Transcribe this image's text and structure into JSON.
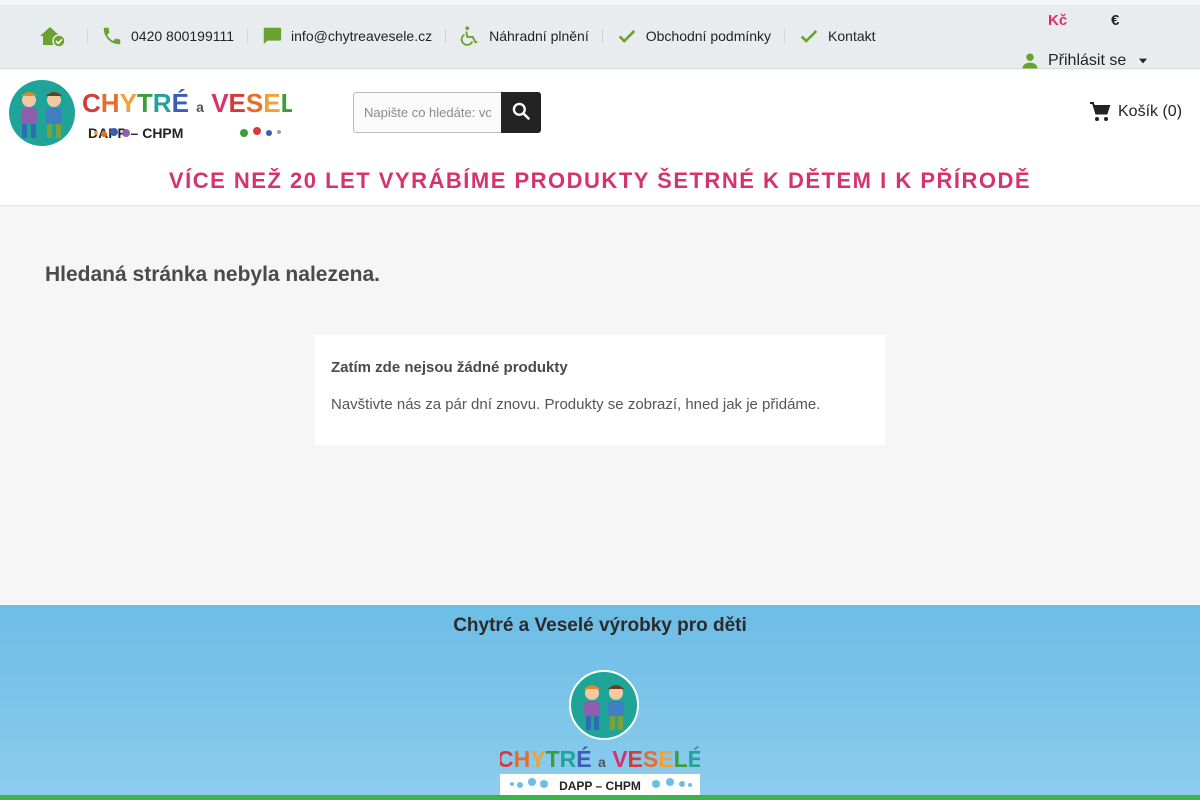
{
  "topbar": {
    "links": [
      {
        "icon": "home-check-icon",
        "label": ""
      },
      {
        "icon": "phone-icon",
        "label": "0420 800199111"
      },
      {
        "icon": "chat-icon",
        "label": "info@chytreavesele.cz"
      },
      {
        "icon": "wheelchair-icon",
        "label": "Náhradní plnění"
      },
      {
        "icon": "check-icon",
        "label": "Obchodní podmínky"
      },
      {
        "icon": "check-icon",
        "label": "Kontakt"
      }
    ],
    "currency_czk": "Kč",
    "currency_eur": "€",
    "login_label": "Přihlásit se"
  },
  "header": {
    "logo_text": "CHYTRÉ a VESELÉ",
    "logo_sub": "DAPP – CHPM",
    "search_placeholder": "Napište co hledáte: vo",
    "cart_label": "Košík (0)",
    "banner": "VÍCE NEŽ 20 LET VYRÁBÍME PRODUKTY ŠETRNÉ K DĚTEM I K PŘÍRODĚ"
  },
  "main": {
    "title": "Hledaná stránka nebyla nalezena.",
    "empty_title": "Zatím zde nejsou žádné produkty",
    "empty_text": "Navštivte nás za pár dní znovu. Produkty se zobrazí, hned jak je přidáme."
  },
  "footer": {
    "title": "Chytré a Veselé výrobky pro děti",
    "logo_text": "CHYTRÉ a VESELÉ",
    "logo_sub": "DAPP – CHPM"
  },
  "colors": {
    "accent_green": "#6aa22f",
    "brand_pink": "#d6336c",
    "footer_blue": "#6dbde6"
  }
}
